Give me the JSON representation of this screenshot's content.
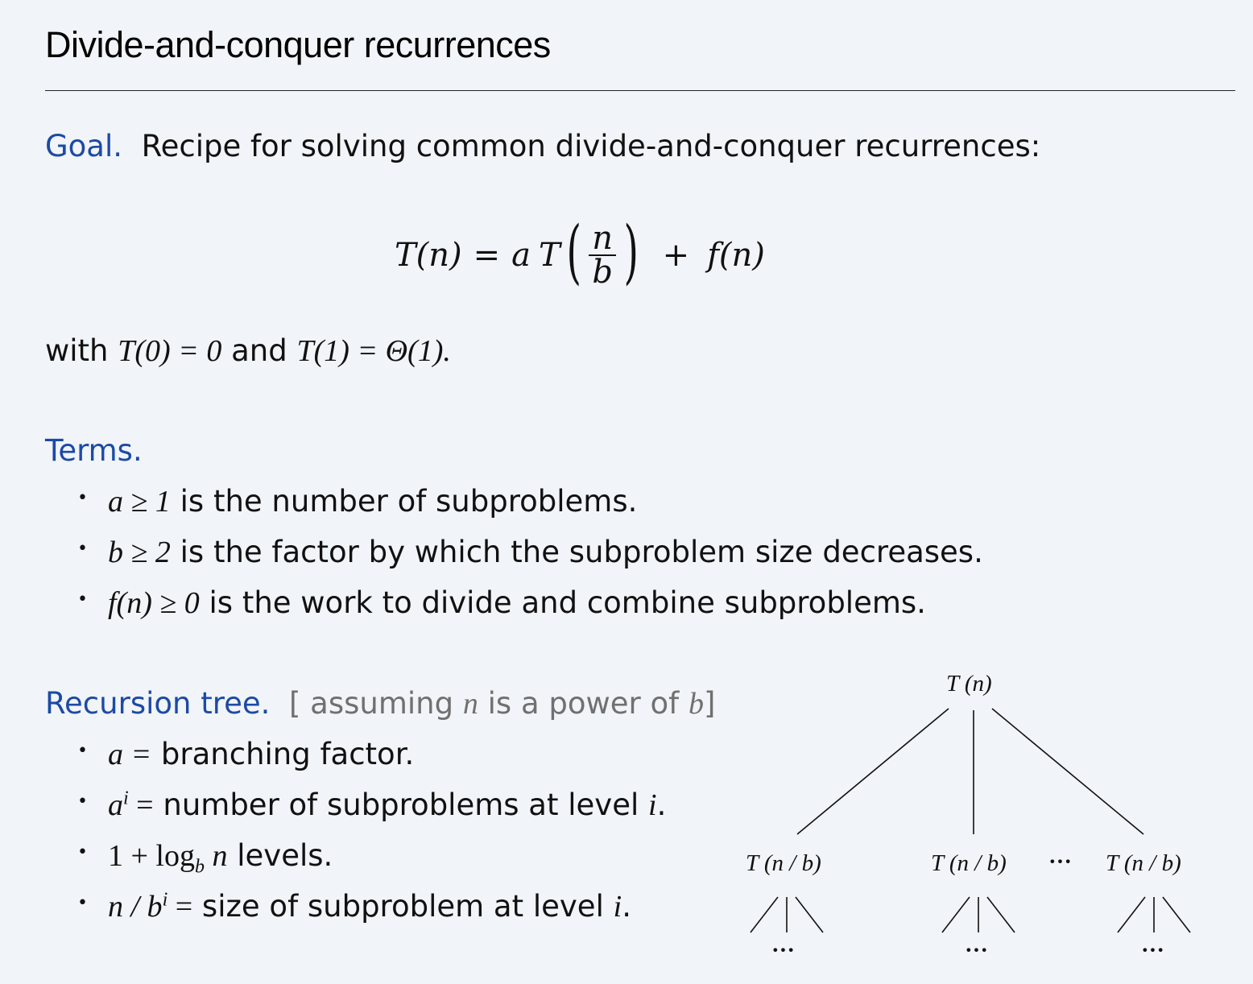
{
  "title": "Divide-and-conquer recurrences",
  "goal": {
    "label": "Goal.",
    "text": "Recipe for solving common divide-and-conquer recurrences:"
  },
  "equation": {
    "lhs": "T(n)",
    "eq": "=",
    "coef": "a",
    "fn": "T",
    "num": "n",
    "den": "b",
    "plus": "+",
    "f": "f(n)"
  },
  "with_line": {
    "w1": "with",
    "c1": "T(0) = 0",
    "w2": "and",
    "c2": "T(1) = Θ(1)."
  },
  "terms": {
    "label": "Terms.",
    "items": [
      {
        "math": "a ≥ 1",
        "text": " is the number of subproblems."
      },
      {
        "math": "b ≥ 2",
        "text": " is the factor by which the subproblem size decreases."
      },
      {
        "math": "f(n) ≥ 0",
        "text": " is the work to divide and combine subproblems."
      }
    ]
  },
  "recursion": {
    "label": "Recursion tree.",
    "note_open": "[ assuming",
    "note_n": "n",
    "note_mid": "is a power of",
    "note_b": "b",
    "note_close": "]",
    "items": [
      {
        "math": "a =",
        "text": " branching factor."
      },
      {
        "math_base": "a",
        "math_sup": "i",
        "math_eq": " =",
        "text": " number of subproblems at level ",
        "var": "i",
        "end": "."
      },
      {
        "math_pre": "1 + log",
        "math_sub": "b",
        "math_post": " n",
        "text": " levels."
      },
      {
        "math_base": "n / b",
        "math_sup": "i",
        "math_eq": " =",
        "text": " size of subproblem at level ",
        "var": "i",
        "end": "."
      }
    ]
  },
  "tree": {
    "root": "T (n)",
    "child": "T (n / b)",
    "dots": "···",
    "leaf_dots": "···"
  }
}
